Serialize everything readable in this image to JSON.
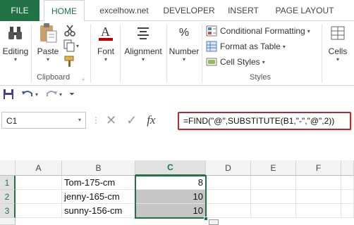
{
  "tabs": {
    "file": "FILE",
    "items": [
      "HOME",
      "excelhow.net",
      "DEVELOPER",
      "INSERT",
      "PAGE LAYOUT"
    ]
  },
  "ribbon": {
    "editing": "Editing",
    "paste": "Paste",
    "clipboard": "Clipboard",
    "font": "Font",
    "alignment": "Alignment",
    "number": "Number",
    "percent_symbol": "%",
    "conditional_formatting": "Conditional Formatting",
    "format_as_table": "Format as Table",
    "cell_styles": "Cell Styles",
    "styles": "Styles",
    "cells": "Cells"
  },
  "formula_bar": {
    "name_box": "C1",
    "fx": "fx",
    "formula": "=FIND(\"@\",SUBSTITUTE(B1,\"-\",\"@\",2))"
  },
  "sheet": {
    "columns": [
      "A",
      "B",
      "C",
      "D",
      "E",
      "F"
    ],
    "rows": [
      "1",
      "2",
      "3"
    ],
    "B": [
      "Tom-175-cm",
      "jenny-165-cm",
      "sunny-156-cm"
    ],
    "C": [
      "8",
      "10",
      "10"
    ]
  },
  "colors": {
    "accent": "#217346",
    "formula_highlight": "#a83232",
    "selection_fill": "#c6c6c6"
  }
}
